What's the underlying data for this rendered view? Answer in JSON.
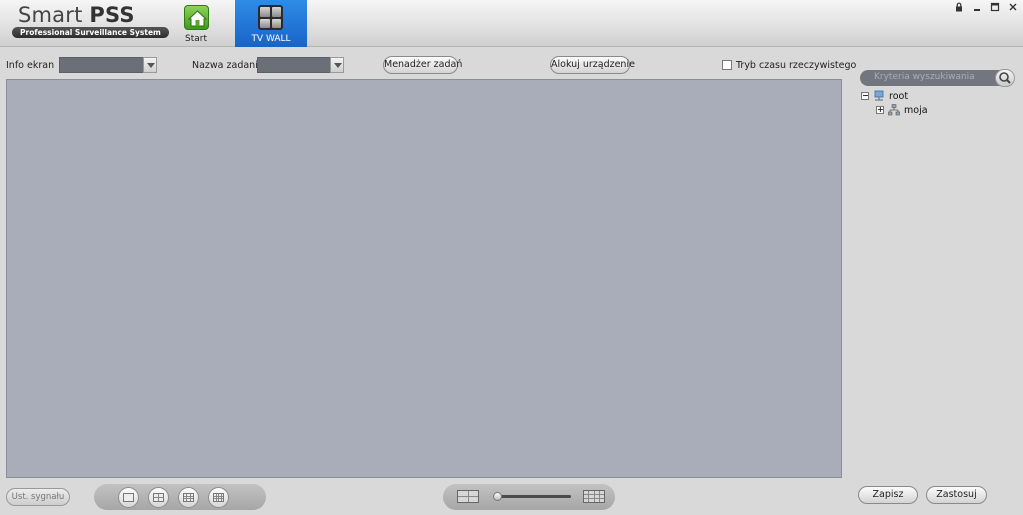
{
  "app": {
    "title_light": "Smart ",
    "title_bold": "PSS",
    "subtitle": "Professional Surveillance System"
  },
  "nav": {
    "start_label": "Start",
    "tvwall_label": "TV WALL"
  },
  "toolbar": {
    "info_label": "Info ekran",
    "info_value": "",
    "task_label": "Nazwa zadania",
    "task_value": "",
    "task_manager_button": "Menadżer zadań",
    "allocate_device_button": "Alokuj urządzenie",
    "realtime_label": "Tryb czasu rzeczywistego",
    "realtime_checked": false
  },
  "search": {
    "placeholder": "Kryteria wyszukiwania"
  },
  "tree": {
    "root_label": "root",
    "child_label": "moja"
  },
  "bottom": {
    "signal_button": "Ust. sygnału",
    "save_button": "Zapisz",
    "apply_button": "Zastosuj",
    "zoom_level": 0
  }
}
